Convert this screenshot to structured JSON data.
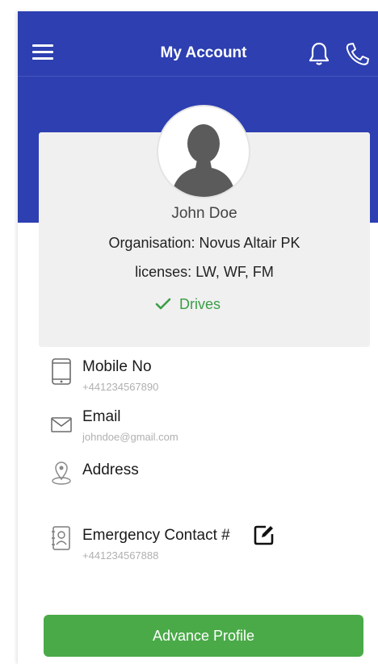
{
  "header": {
    "title": "My Account",
    "menu_icon": "hamburger-menu-icon",
    "notifications_icon": "bell-icon",
    "call_icon": "phone-icon",
    "color": "#2d3fb1"
  },
  "profile": {
    "avatar_icon": "user-avatar-icon",
    "name": "John Doe",
    "organisation": "Organisation: Novus Altair PK",
    "licenses": "licenses: LW, WF, FM",
    "drives_label": "Drives",
    "drives_icon": "check-icon",
    "drives_color": "#3a9e47",
    "card_color": "#f0f0f0"
  },
  "contact": {
    "mobile": {
      "label": "Mobile No",
      "value": "+441234567890",
      "icon": "mobile-phone-icon"
    },
    "email": {
      "label": "Email",
      "value": "johndoe@gmail.com",
      "icon": "envelope-icon"
    },
    "address": {
      "label": "Address",
      "value": "",
      "icon": "location-pin-icon"
    },
    "emergency": {
      "label": "Emergency Contact #",
      "value": "+441234567888",
      "icon": "contact-book-icon",
      "edit_icon": "edit-icon"
    }
  },
  "actions": {
    "advance_profile_label": "Advance Profile",
    "button_color": "#4aaa48"
  }
}
